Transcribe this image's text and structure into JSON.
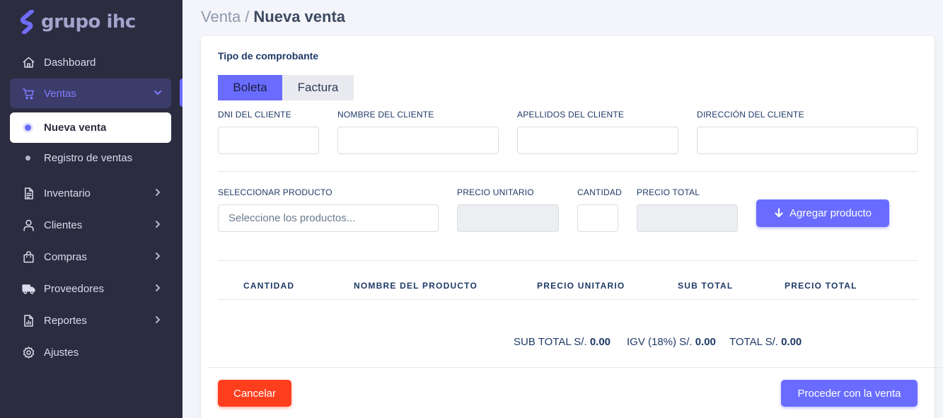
{
  "brand": {
    "name": "grupo ihc",
    "accent": "#696cff",
    "sidebar_bg": "#2b2c40"
  },
  "sidebar": {
    "items": [
      {
        "label": "Dashboard",
        "icon": "home-icon"
      },
      {
        "label": "Ventas",
        "icon": "cart-icon",
        "expanded": true
      },
      {
        "label": "Inventario",
        "icon": "file-text-icon"
      },
      {
        "label": "Clientes",
        "icon": "user-icon"
      },
      {
        "label": "Compras",
        "icon": "shopping-bag-icon"
      },
      {
        "label": "Proveedores",
        "icon": "truck-icon"
      },
      {
        "label": "Reportes",
        "icon": "report-icon"
      },
      {
        "label": "Ajustes",
        "icon": "gear-icon"
      }
    ],
    "subitems": [
      {
        "label": "Nueva venta",
        "current": true
      },
      {
        "label": "Registro de ventas",
        "current": false
      }
    ]
  },
  "breadcrumb": {
    "parent": "Venta",
    "separator": "/",
    "current": "Nueva venta"
  },
  "form": {
    "section_title": "Tipo de comprobante",
    "tabs": [
      {
        "label": "Boleta",
        "active": true
      },
      {
        "label": "Factura",
        "active": false
      }
    ],
    "client_fields": [
      {
        "label": "DNI DEL CLIENTE",
        "value": ""
      },
      {
        "label": "NOMBRE DEL CLIENTE",
        "value": ""
      },
      {
        "label": "APELLIDOS DEL CLIENTE",
        "value": ""
      },
      {
        "label": "DIRECCIÓN DEL CLIENTE",
        "value": ""
      }
    ],
    "product_fields": {
      "product_label": "SELECCIONAR PRODUCTO",
      "product_placeholder": "Seleccione los productos...",
      "unit_price_label": "PRECIO UNITARIO",
      "quantity_label": "CANTIDAD",
      "total_price_label": "PRECIO TOTAL"
    },
    "add_button": "Agregar producto"
  },
  "table": {
    "headers": [
      "CANTIDAD",
      "NOMBRE DEL PRODUCTO",
      "PRECIO UNITARIO",
      "SUB TOTAL",
      "PRECIO TOTAL"
    ],
    "rows": []
  },
  "totals": {
    "subtotal_label": "SUB TOTAL S/.",
    "subtotal_value": "0.00",
    "igv_label": "IGV (18%) S/.",
    "igv_value": "0.00",
    "total_label": "TOTAL S/.",
    "total_value": "0.00"
  },
  "actions": {
    "cancel": "Cancelar",
    "proceed": "Proceder con la venta",
    "cancel_color": "#ff3e1d"
  }
}
